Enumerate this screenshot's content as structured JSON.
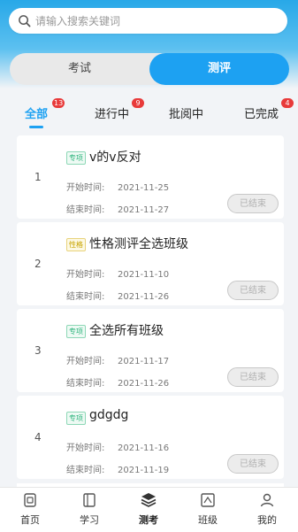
{
  "search": {
    "placeholder": "请输入搜索关键词"
  },
  "segment": {
    "left_label": "考试",
    "right_label": "测评",
    "selected": "测评"
  },
  "tabs": [
    {
      "label": "全部",
      "badge": "13",
      "active": true
    },
    {
      "label": "进行中",
      "badge": "9",
      "active": false
    },
    {
      "label": "批阅中",
      "badge": "",
      "active": false
    },
    {
      "label": "已完成",
      "badge": "4",
      "active": false
    }
  ],
  "items": [
    {
      "index": "1",
      "tag": "专项",
      "title": "v的v反对",
      "start_label": "开始时间:",
      "start": "2021-11-25",
      "end_label": "结束时间:",
      "end": "2021-11-27",
      "status": "已结束"
    },
    {
      "index": "2",
      "tag": "性格",
      "title": "性格测评全选班级",
      "start_label": "开始时间:",
      "start": "2021-11-10",
      "end_label": "结束时间:",
      "end": "2021-11-26",
      "status": "已结束"
    },
    {
      "index": "3",
      "tag": "专项",
      "title": "全选所有班级",
      "start_label": "开始时间:",
      "start": "2021-11-17",
      "end_label": "结束时间:",
      "end": "2021-11-26",
      "status": "已结束"
    },
    {
      "index": "4",
      "tag": "专项",
      "title": "gdgdg",
      "start_label": "开始时间:",
      "start": "2021-11-16",
      "end_label": "结束时间:",
      "end": "2021-11-19",
      "status": "已结束"
    }
  ],
  "bottom_nav": [
    {
      "label": "首页",
      "icon": "home-icon"
    },
    {
      "label": "学习",
      "icon": "book-icon"
    },
    {
      "label": "测考",
      "icon": "layers-icon",
      "active": true
    },
    {
      "label": "班级",
      "icon": "class-icon"
    },
    {
      "label": "我的",
      "icon": "user-icon"
    }
  ],
  "colors": {
    "accent": "#1da1f2",
    "badge": "#e83a3a"
  }
}
